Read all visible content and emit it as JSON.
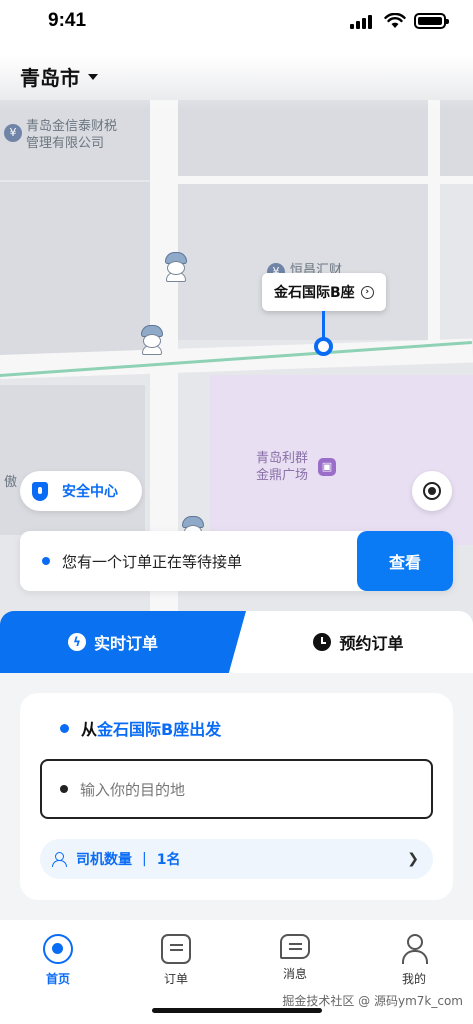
{
  "status_bar": {
    "time": "9:41"
  },
  "header": {
    "city": "青岛市"
  },
  "map": {
    "poi_labels": [
      "青岛金信泰财税\n管理有限公司",
      "恒昌汇财",
      "青岛利群\n金鼎广场",
      "傲"
    ],
    "pin_label": "金石国际B座"
  },
  "safety": {
    "label": "安全中心"
  },
  "notice": {
    "text": "您有一个订单正在等待接单",
    "button": "查看"
  },
  "tabs": [
    {
      "label": "实时订单",
      "icon": "bolt-icon",
      "active": true
    },
    {
      "label": "预约订单",
      "icon": "clock-icon",
      "active": false
    }
  ],
  "trip": {
    "from_prefix": "从",
    "from_place": "金石国际B座出发",
    "dest_placeholder": "输入你的目的地",
    "drivers_label": "司机数量",
    "drivers_sep": "|",
    "drivers_count": "1名"
  },
  "nav": [
    {
      "label": "首页",
      "icon": "home-icon",
      "active": true
    },
    {
      "label": "订单",
      "icon": "order-icon",
      "active": false
    },
    {
      "label": "消息",
      "icon": "message-icon",
      "active": false
    },
    {
      "label": "我的",
      "icon": "profile-icon",
      "active": false
    }
  ],
  "watermark": "掘金技术社区 @ 源码ym7k_com",
  "colors": {
    "primary": "#0a6cf5",
    "background": "#f3f4f6"
  }
}
